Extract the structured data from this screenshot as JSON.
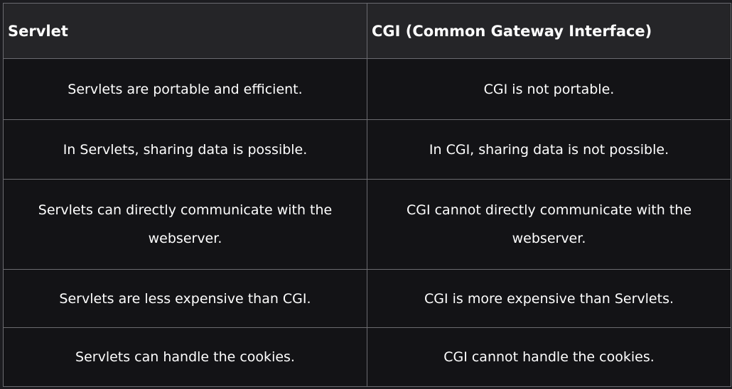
{
  "table": {
    "headers": [
      "Servlet",
      "CGI (Common Gateway Interface)"
    ],
    "rows": [
      [
        "Servlets are portable and efficient.",
        "CGI is not portable."
      ],
      [
        "In Servlets, sharing data is possible.",
        "In CGI, sharing data is not possible."
      ],
      [
        "Servlets can directly communicate with the webserver.",
        "CGI cannot directly communicate with the webserver."
      ],
      [
        "Servlets are less expensive than CGI.",
        "CGI is more expensive than Servlets."
      ],
      [
        "Servlets can handle the cookies.",
        "CGI cannot handle the cookies."
      ]
    ]
  },
  "colors": {
    "header_bg": "#252528",
    "cell_bg": "#131316",
    "border": "#6b6b70",
    "text": "#ffffff"
  }
}
